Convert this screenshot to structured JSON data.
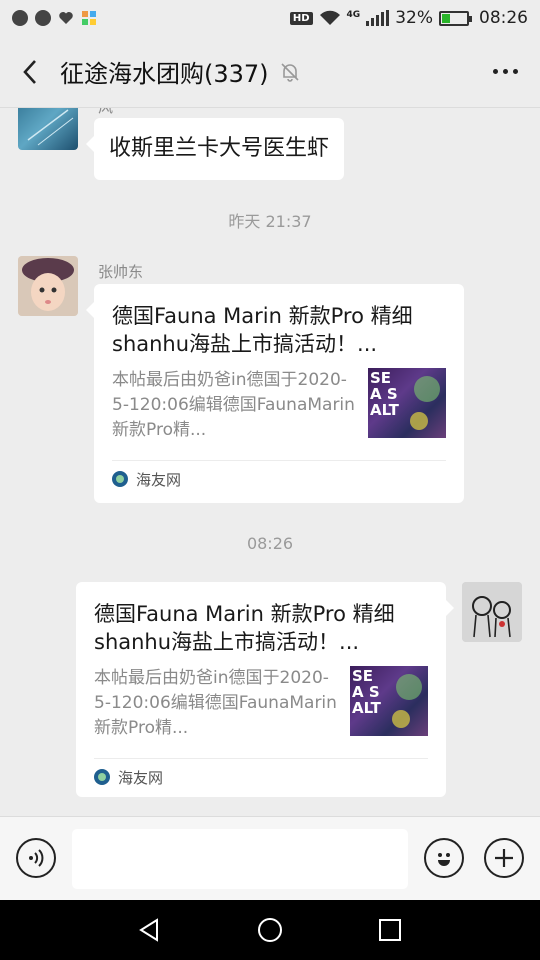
{
  "status_bar": {
    "network_label": "HD",
    "cell_type": "4G",
    "battery_percent": "32%",
    "battery_level": 0.32,
    "time": "08:26"
  },
  "title_bar": {
    "chat_title": "征途海水团购(337)"
  },
  "messages": {
    "first": {
      "sender_fragment": "风",
      "text": "收斯里兰卡大号医生虾"
    },
    "timestamp_1": "昨天 21:37",
    "second": {
      "sender_name": "张帅东",
      "card_title": "德国Fauna Marin 新款Pro 精细shanhu海盐上市搞活动！...",
      "card_desc": "本帖最后由奶爸in德国于2020-5-120:06编辑德国FaunaMarin新款Pro精...",
      "thumb_text": "SEA SALT",
      "source": "海友网"
    },
    "timestamp_2": "08:26",
    "third": {
      "card_title": "德国Fauna Marin 新款Pro 精细shanhu海盐上市搞活动！...",
      "card_desc": "本帖最后由奶爸in德国于2020-5-120:06编辑德国FaunaMarin新款Pro精...",
      "thumb_text": "SEA SALT",
      "source": "海友网"
    }
  },
  "input_bar": {
    "message_value": ""
  },
  "colors": {
    "background": "#ededed",
    "bubble": "#ffffff",
    "battery_fill": "#2ab52a",
    "navbar": "#000000"
  }
}
